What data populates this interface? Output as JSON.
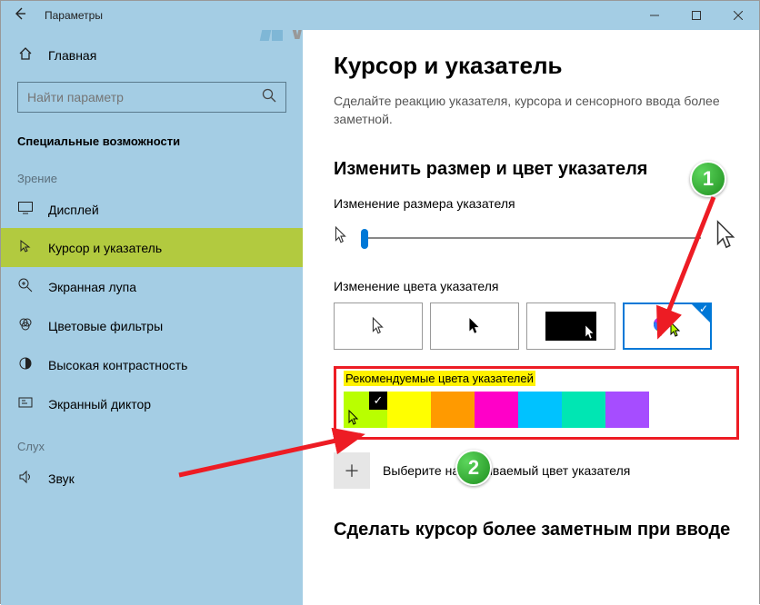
{
  "window": {
    "title": "Параметры"
  },
  "watermark": "WINNOTE.RU",
  "sidebar": {
    "home": "Главная",
    "search_placeholder": "Найти параметр",
    "section": "Специальные возможности",
    "group_vision": "Зрение",
    "group_hearing": "Слух",
    "items": [
      {
        "icon": "display",
        "label": "Дисплей"
      },
      {
        "icon": "cursor",
        "label": "Курсор и указатель"
      },
      {
        "icon": "magnifier",
        "label": "Экранная лупа"
      },
      {
        "icon": "filters",
        "label": "Цветовые фильтры"
      },
      {
        "icon": "contrast",
        "label": "Высокая контрастность"
      },
      {
        "icon": "narrator",
        "label": "Экранный диктор"
      }
    ],
    "hearing_items": [
      {
        "icon": "sound",
        "label": "Звук"
      }
    ]
  },
  "content": {
    "title": "Курсор и указатель",
    "subtitle": "Сделайте реакцию указателя, курсора и сенсорного ввода более заметной.",
    "section1": "Изменить размер и цвет указателя",
    "size_label": "Изменение размера указателя",
    "color_label": "Изменение цвета указателя",
    "rec_label": "Рекомендуемые цвета указателей",
    "rec_colors": [
      "#b9ff00",
      "#ffff00",
      "#ff9a00",
      "#ff00c8",
      "#00c2ff",
      "#00e6b3",
      "#a64dff"
    ],
    "custom_label": "Выберите настраиваемый цвет указателя",
    "section2": "Сделать курсор более заметным при вводе"
  },
  "badges": {
    "one": "1",
    "two": "2"
  }
}
